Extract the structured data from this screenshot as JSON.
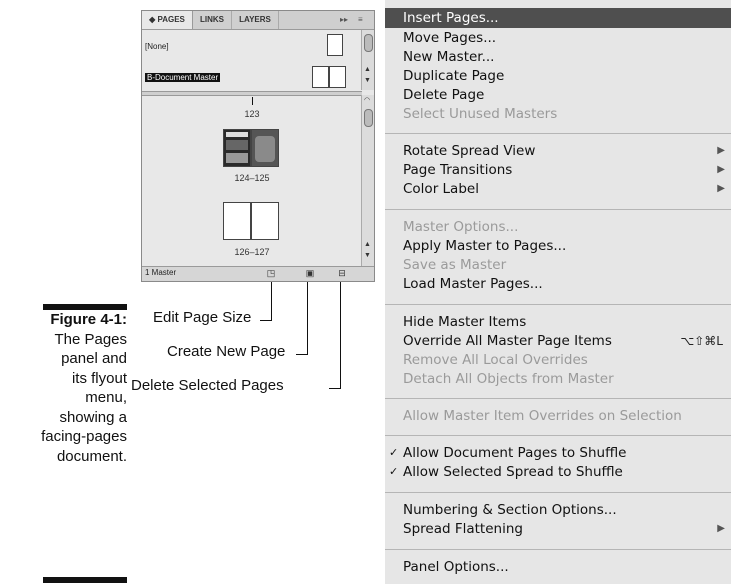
{
  "caption": {
    "figure": "Figure 4-1:",
    "lines": [
      "The Pages",
      "panel and",
      "its flyout",
      "menu,",
      "showing a",
      "facing-pages",
      "document."
    ]
  },
  "panel": {
    "tabs": [
      "◆ PAGES",
      "LINKS",
      "LAYERS"
    ],
    "tab_controls": [
      "▸▸",
      "≡"
    ],
    "masters": {
      "none": "[None]",
      "selected": "B-Document Master"
    },
    "pages": {
      "p1": "123",
      "p2": "124–125",
      "p3": "126–127"
    },
    "footer_label": "1 Master",
    "icons": {
      "edit_size": "page-size-icon",
      "new_page": "new-page-icon",
      "delete": "trash-icon"
    }
  },
  "callouts": {
    "edit_size": "Edit Page Size",
    "create_new": "Create New Page",
    "delete_selected": "Delete Selected Pages"
  },
  "menu": {
    "items": [
      {
        "label": "Insert Pages...",
        "state": "highlighted"
      },
      {
        "label": "Move Pages..."
      },
      {
        "label": "New Master..."
      },
      {
        "label": "Duplicate Page"
      },
      {
        "label": "Delete Page"
      },
      {
        "label": "Select Unused Masters",
        "state": "disabled"
      },
      {
        "label": "Rotate Spread View",
        "submenu": true
      },
      {
        "label": "Page Transitions",
        "submenu": true
      },
      {
        "label": "Color Label",
        "submenu": true
      },
      {
        "label": "Master Options...",
        "state": "disabled"
      },
      {
        "label": "Apply Master to Pages..."
      },
      {
        "label": "Save as Master",
        "state": "disabled"
      },
      {
        "label": "Load Master Pages..."
      },
      {
        "label": "Hide Master Items"
      },
      {
        "label": "Override All Master Page Items",
        "shortcut": "⌥⇧⌘L"
      },
      {
        "label": "Remove All Local Overrides",
        "state": "disabled"
      },
      {
        "label": "Detach All Objects from Master",
        "state": "disabled"
      },
      {
        "label": "Allow Master Item Overrides on Selection",
        "state": "disabled"
      },
      {
        "label": "Allow Document Pages to Shuffle",
        "checked": "✓"
      },
      {
        "label": "Allow Selected Spread to Shuffle",
        "checked": "✓"
      },
      {
        "label": "Numbering & Section Options..."
      },
      {
        "label": "Spread Flattening",
        "submenu": true
      },
      {
        "label": "Panel Options..."
      }
    ],
    "submenu_arrow": "▶"
  }
}
